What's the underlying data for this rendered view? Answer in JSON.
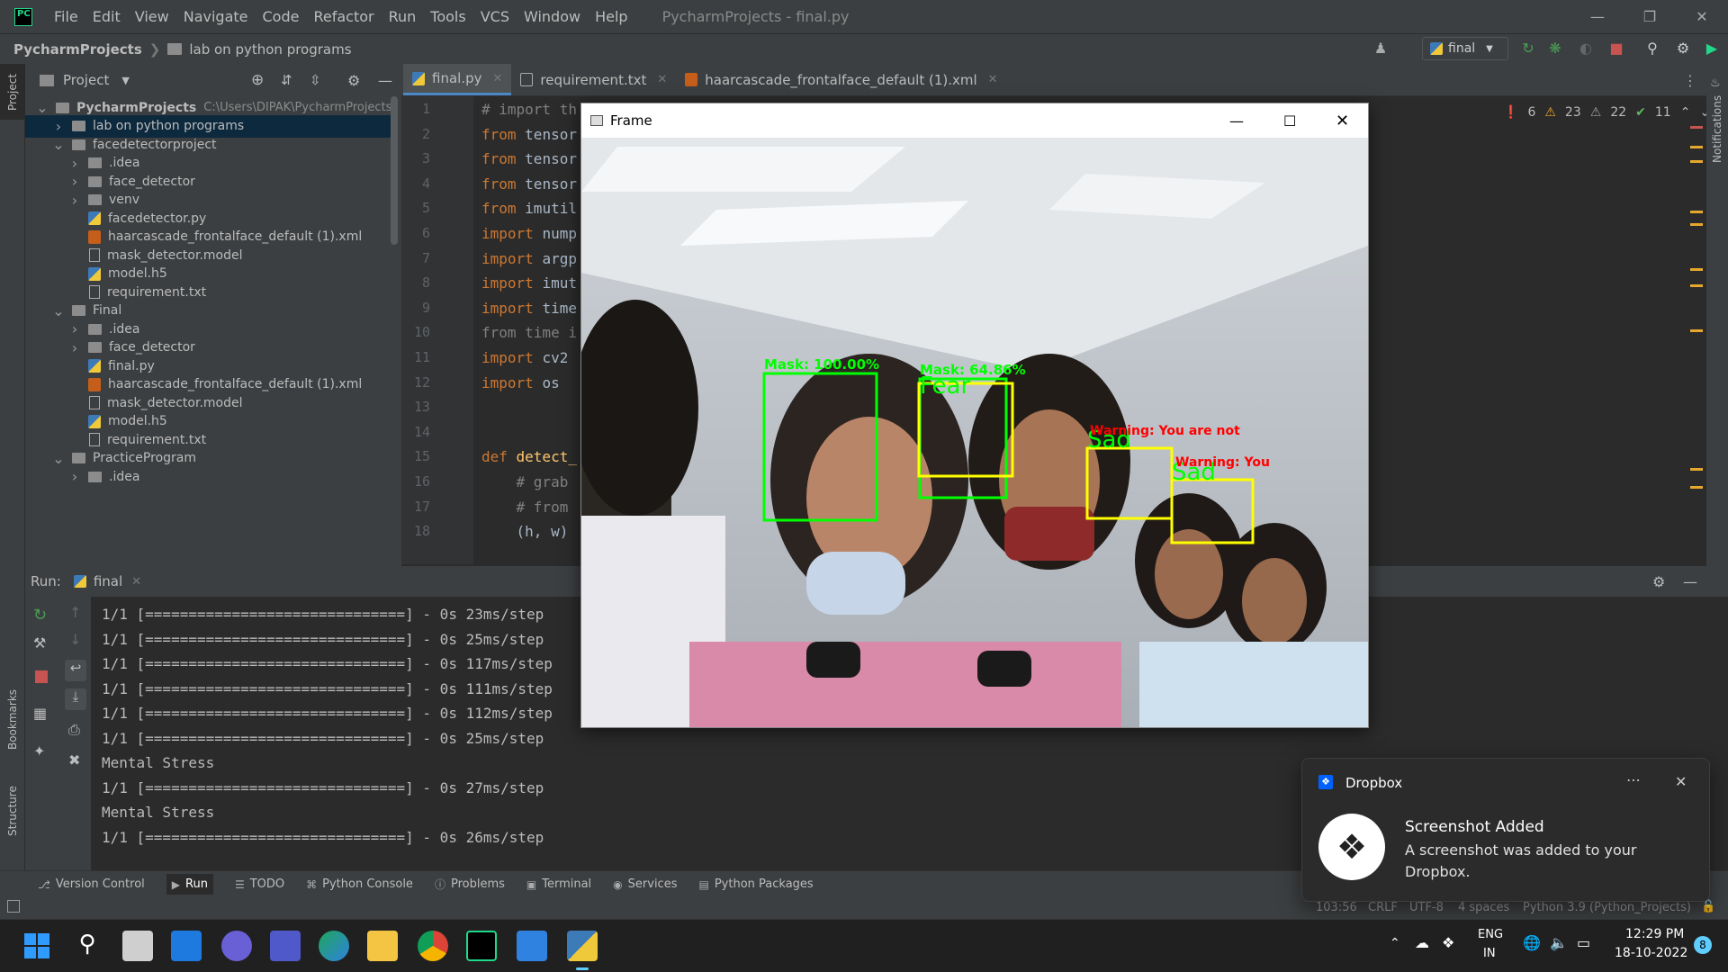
{
  "menubar": {
    "items": [
      "File",
      "Edit",
      "View",
      "Navigate",
      "Code",
      "Refactor",
      "Run",
      "Tools",
      "VCS",
      "Window",
      "Help"
    ],
    "title": "PycharmProjects - final.py"
  },
  "navbar": {
    "root": "PycharmProjects",
    "folder": "lab on python programs",
    "run_config": "final"
  },
  "project_panel": {
    "title": "Project",
    "tree": [
      {
        "label": "PycharmProjects",
        "path": "C:\\Users\\DIPAK\\PycharmProjects",
        "depth": 0,
        "expanded": true,
        "kind": "folder",
        "bold": true
      },
      {
        "label": "lab on python programs",
        "depth": 1,
        "expanded": false,
        "kind": "folder",
        "selected": true
      },
      {
        "label": "facedetectorproject",
        "depth": 1,
        "expanded": true,
        "kind": "folder"
      },
      {
        "label": ".idea",
        "depth": 2,
        "expanded": false,
        "kind": "folder"
      },
      {
        "label": "face_detector",
        "depth": 2,
        "expanded": false,
        "kind": "folder"
      },
      {
        "label": "venv",
        "depth": 2,
        "expanded": false,
        "kind": "folder"
      },
      {
        "label": "facedetector.py",
        "depth": 2,
        "kind": "py"
      },
      {
        "label": "haarcascade_frontalface_default (1).xml",
        "depth": 2,
        "kind": "xml"
      },
      {
        "label": "mask_detector.model",
        "depth": 2,
        "kind": "txt"
      },
      {
        "label": "model.h5",
        "depth": 2,
        "kind": "py"
      },
      {
        "label": "requirement.txt",
        "depth": 2,
        "kind": "txt"
      },
      {
        "label": "Final",
        "depth": 1,
        "expanded": true,
        "kind": "folder"
      },
      {
        "label": ".idea",
        "depth": 2,
        "expanded": false,
        "kind": "folder"
      },
      {
        "label": "face_detector",
        "depth": 2,
        "expanded": false,
        "kind": "folder"
      },
      {
        "label": "final.py",
        "depth": 2,
        "kind": "py"
      },
      {
        "label": "haarcascade_frontalface_default (1).xml",
        "depth": 2,
        "kind": "xml"
      },
      {
        "label": "mask_detector.model",
        "depth": 2,
        "kind": "txt"
      },
      {
        "label": "model.h5",
        "depth": 2,
        "kind": "py"
      },
      {
        "label": "requirement.txt",
        "depth": 2,
        "kind": "txt"
      },
      {
        "label": "PracticeProgram",
        "depth": 1,
        "expanded": true,
        "kind": "folder"
      },
      {
        "label": ".idea",
        "depth": 2,
        "expanded": false,
        "kind": "folder"
      }
    ]
  },
  "tabs": [
    {
      "label": "final.py",
      "active": true,
      "kind": "py"
    },
    {
      "label": "requirement.txt",
      "active": false,
      "kind": "txt"
    },
    {
      "label": "haarcascade_frontalface_default (1).xml",
      "active": false,
      "kind": "xml"
    }
  ],
  "inspections": {
    "errors": "6",
    "warnings": "23",
    "weak_warnings": "22",
    "ok": "11"
  },
  "code_lines": [
    {
      "n": "1",
      "parts": [
        [
          "cm",
          "# import th"
        ]
      ]
    },
    {
      "n": "2",
      "parts": [
        [
          "kw",
          "from "
        ],
        [
          "",
          "tensor"
        ]
      ]
    },
    {
      "n": "3",
      "parts": [
        [
          "kw",
          "from "
        ],
        [
          "",
          "tensor"
        ]
      ]
    },
    {
      "n": "4",
      "parts": [
        [
          "kw",
          "from "
        ],
        [
          "",
          "tensor"
        ]
      ]
    },
    {
      "n": "5",
      "parts": [
        [
          "kw",
          "from "
        ],
        [
          "",
          "imutil"
        ]
      ]
    },
    {
      "n": "6",
      "parts": [
        [
          "kw",
          "import "
        ],
        [
          "",
          "nump"
        ]
      ]
    },
    {
      "n": "7",
      "parts": [
        [
          "kw",
          "import "
        ],
        [
          "",
          "argp"
        ]
      ]
    },
    {
      "n": "8",
      "parts": [
        [
          "kw",
          "import "
        ],
        [
          "",
          "imut"
        ]
      ]
    },
    {
      "n": "9",
      "parts": [
        [
          "kw",
          "import "
        ],
        [
          "",
          "time"
        ]
      ]
    },
    {
      "n": "10",
      "parts": [
        [
          "cm",
          "from time i"
        ]
      ]
    },
    {
      "n": "11",
      "parts": [
        [
          "kw",
          "import "
        ],
        [
          "",
          "cv2"
        ]
      ]
    },
    {
      "n": "12",
      "parts": [
        [
          "kw",
          "import "
        ],
        [
          "",
          "os"
        ]
      ]
    },
    {
      "n": "13",
      "parts": []
    },
    {
      "n": "14",
      "parts": []
    },
    {
      "n": "15",
      "parts": [
        [
          "kw",
          "def "
        ],
        [
          "fn",
          "detect_"
        ]
      ]
    },
    {
      "n": "16",
      "parts": [
        [
          "cm",
          "    # grab"
        ]
      ]
    },
    {
      "n": "17",
      "parts": [
        [
          "cm",
          "    # from"
        ]
      ]
    },
    {
      "n": "18",
      "parts": [
        [
          "",
          "    (h, w)"
        ]
      ]
    }
  ],
  "frame_window": {
    "title": "Frame",
    "detections": [
      {
        "label": "Mask: 100.00%",
        "color": "#00ff00"
      },
      {
        "label": "Mask: 64.86%",
        "color": "#00ff00"
      },
      {
        "label": "Fear",
        "color": "#00ff00"
      },
      {
        "label": "Sad",
        "color": "#00ff00"
      },
      {
        "label": "Sad",
        "color": "#00ff00"
      },
      {
        "label": "Warning: You are not",
        "color": "#ff0000"
      },
      {
        "label": "Warning: You",
        "color": "#ff0000"
      }
    ]
  },
  "run_panel": {
    "label": "Run:",
    "config": "final"
  },
  "console_lines": [
    "1/1 [==============================] - 0s 23ms/step",
    "1/1 [==============================] - 0s 25ms/step",
    "1/1 [==============================] - 0s 117ms/step",
    "1/1 [==============================] - 0s 111ms/step",
    "1/1 [==============================] - 0s 112ms/step",
    "1/1 [==============================] - 0s 25ms/step",
    "Mental Stress",
    "1/1 [==============================] - 0s 27ms/step",
    "Mental Stress",
    "1/1 [==============================] - 0s 26ms/step"
  ],
  "bottom_tools": [
    "Version Control",
    "Run",
    "TODO",
    "Python Console",
    "Problems",
    "Terminal",
    "Services",
    "Python Packages"
  ],
  "left_tool_labels": {
    "project": "Project",
    "bookmarks": "Bookmarks",
    "structure": "Structure"
  },
  "right_tool_label": "Notifications",
  "statusbar": {
    "position": "103:56",
    "line_sep": "CRLF",
    "encoding": "UTF-8",
    "indent": "4 spaces",
    "interpreter": "Python 3.9 (Python_Projects)"
  },
  "toast": {
    "app": "Dropbox",
    "title": "Screenshot Added",
    "message": "A screenshot was added to your Dropbox."
  },
  "taskbar": {
    "lang1": "ENG",
    "lang2": "IN",
    "time": "12:29 PM",
    "date": "18-10-2022",
    "badge": "8"
  },
  "colors": {
    "accent": "#4a88c7",
    "ide_bg": "#2b2b2b",
    "panel_bg": "#3c3f41",
    "box_green": "#00ff00",
    "box_yellow": "#ffff00",
    "warning_red": "#ff0000"
  }
}
